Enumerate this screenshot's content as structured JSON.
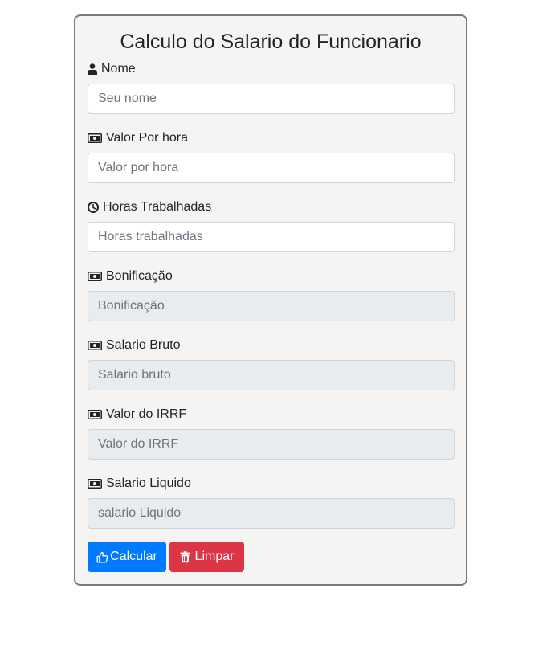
{
  "form": {
    "title": "Calculo do Salario do Funcionario",
    "fields": [
      {
        "label": "Nome",
        "icon": "user-icon",
        "placeholder": "Seu nome",
        "readonly": false
      },
      {
        "label": "Valor Por hora",
        "icon": "money-bill-icon",
        "placeholder": "Valor por hora",
        "readonly": false
      },
      {
        "label": "Horas Trabalhadas",
        "icon": "clock-icon",
        "placeholder": "Horas trabalhadas",
        "readonly": false
      },
      {
        "label": "Bonificação",
        "icon": "money-bill-icon",
        "placeholder": "Bonificação",
        "readonly": true
      },
      {
        "label": "Salario Bruto",
        "icon": "money-bill-icon",
        "placeholder": "Salario bruto",
        "readonly": true
      },
      {
        "label": "Valor do IRRF",
        "icon": "money-bill-icon",
        "placeholder": "Valor do IRRF",
        "readonly": true
      },
      {
        "label": "Salario Liquido",
        "icon": "money-bill-icon",
        "placeholder": "salario Liquido",
        "readonly": true
      }
    ],
    "buttons": {
      "calcular": {
        "label": "Calcular",
        "icon": "thumbs-up-icon",
        "color": "#007bff"
      },
      "limpar": {
        "label": "Limpar",
        "icon": "trash-icon",
        "color": "#dc3545"
      }
    }
  },
  "colors": {
    "card_background": "#f5f4f2",
    "card_border": "#7a7a7a",
    "readonly_background": "#e9ecef"
  }
}
